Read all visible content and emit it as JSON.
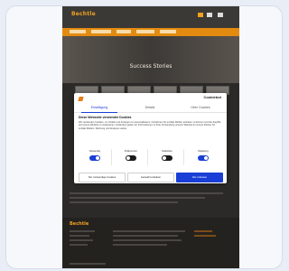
{
  "site": {
    "logo_main": "Bechtle",
    "logo_sub": "",
    "hero_title": "Success Stories"
  },
  "cookie_dialog": {
    "brand": "Cookiebot",
    "tabs": [
      "Einwilligung",
      "Details",
      "Über Cookies"
    ],
    "heading": "Diese Webseite verwendet Cookies",
    "body": "Wir verwenden Cookies, um Inhalte und Anzeigen zu personalisieren, Funktionen für soziale Medien anbieten zu können und die Zugriffe auf unsere Website zu analysieren. Außerdem geben wir Informationen zu Ihrer Verwendung unserer Website an unsere Partner für soziale Medien, Werbung und Analysen weiter.",
    "toggles": [
      {
        "label": "Notwendig",
        "state": "on"
      },
      {
        "label": "Präferenzen",
        "state": "off"
      },
      {
        "label": "Statistiken",
        "state": "off"
      },
      {
        "label": "Marketing",
        "state": "on"
      }
    ],
    "buttons": {
      "deny": "Nur notwendige Cookies",
      "select": "Auswahl erlauben",
      "accept": "Alle zulassen"
    }
  },
  "colors": {
    "accent": "#e38b10",
    "primary_button": "#1a3fd6"
  }
}
